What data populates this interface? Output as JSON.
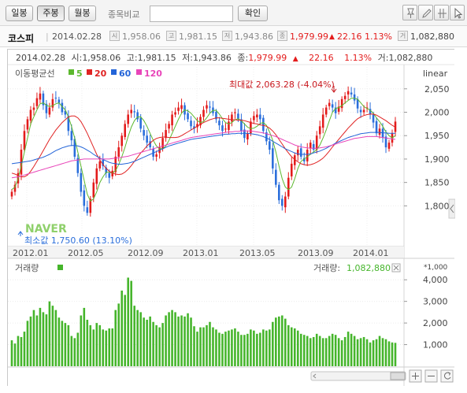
{
  "toolbar": {
    "tabs": [
      {
        "label": "일봉",
        "active": false
      },
      {
        "label": "주봉",
        "active": true
      },
      {
        "label": "월봉",
        "active": false
      }
    ],
    "compare_label": "종목비교",
    "compare_input_value": "",
    "confirm_label": "확인",
    "tools": [
      "pin-icon",
      "pencil-icon",
      "crosshair-icon",
      "cursor-icon"
    ]
  },
  "infobar": {
    "index_name": "코스피",
    "date": "2014.02.28",
    "open_icon": "시",
    "open": "1,958.06",
    "high_icon": "고",
    "high": "1,981.15",
    "low_icon": "저",
    "low": "1,943.86",
    "close_icon": "종",
    "close": "1,979.99",
    "change_arrow": "▲",
    "change": "22.16",
    "change_pct": "1.13%",
    "volume_icon": "거",
    "volume": "1,082,880"
  },
  "chart": {
    "header": {
      "date": "2014.02.28",
      "open_label": "시:",
      "open": "1,958.06",
      "high_label": "고:",
      "high": "1,981.15",
      "low_label": "저:",
      "low": "1,943.86",
      "close_label": "종:",
      "close": "1,979.99",
      "arrow": "▲",
      "change": "22.16",
      "change_pct": "1.13%",
      "volume_label": "거:",
      "volume": "1,082,880"
    },
    "ma_label": "이동평균선",
    "ma_legend": [
      {
        "label": "5",
        "color": "#5cb82e"
      },
      {
        "label": "20",
        "color": "#e02323"
      },
      {
        "label": "60",
        "color": "#2364d8"
      },
      {
        "label": "120",
        "color": "#e845b9"
      }
    ],
    "scale_label": "linear",
    "max_annotation": "최대값 2,063.28 (-4.04%)",
    "min_annotation": "최소값 1,750.60 (13.10%)",
    "watermark": "NAVER",
    "volume_title": "거래량",
    "volume_readout_label": "거래량:",
    "volume_readout_value": "1,082,880",
    "volume_unit": "*1,000",
    "colors": {
      "up": "#e31b1b",
      "down": "#2a6edb",
      "volume": "#45b52b"
    }
  },
  "chart_data": [
    {
      "type": "candlestick",
      "title": "",
      "x_tick_labels": [
        "2012.01",
        "2012.05",
        "2012.09",
        "2013.01",
        "2013.05",
        "2013.09",
        "2014.01"
      ],
      "y_tick_labels": [
        "2,050",
        "2,000",
        "1,950",
        "1,900",
        "1,850",
        "1,800"
      ],
      "ylim": [
        1730,
        2090
      ],
      "scale": "linear",
      "series": [
        {
          "name": "close",
          "values": [
            1830,
            1845,
            1870,
            1920,
            1960,
            1985,
            2005,
            2010,
            2030,
            2040,
            2015,
            1998,
            2010,
            2028,
            2030,
            2020,
            2000,
            1995,
            1960,
            1940,
            1905,
            1870,
            1830,
            1800,
            1785,
            1815,
            1850,
            1880,
            1895,
            1885,
            1870,
            1860,
            1875,
            1905,
            1925,
            1950,
            1975,
            1995,
            2005,
            2000,
            1985,
            1965,
            1950,
            1935,
            1925,
            1905,
            1910,
            1925,
            1945,
            1962,
            1975,
            1995,
            2000,
            2010,
            2015,
            1995,
            1985,
            1970,
            1965,
            1975,
            1990,
            2005,
            2015,
            2010,
            1998,
            1985,
            1972,
            1960,
            1965,
            1980,
            1995,
            2000,
            1985,
            1960,
            1945,
            1955,
            1980,
            1992,
            1995,
            1985,
            1960,
            1938,
            1920,
            1880,
            1845,
            1812,
            1800,
            1820,
            1860,
            1890,
            1908,
            1920,
            1905,
            1895,
            1920,
            1935,
            1920,
            1950,
            1970,
            1995,
            2010,
            2020,
            2010,
            1998,
            2012,
            2028,
            2035,
            2045,
            2038,
            2025,
            2008,
            2000,
            2005,
            2010,
            1995,
            1978,
            1955,
            1965,
            1945,
            1925,
            1935,
            1955,
            1980
          ]
        },
        {
          "name": "5",
          "values": [
            1835,
            1840,
            1858,
            1885,
            1915,
            1945,
            1975,
            1990,
            2005,
            2018,
            2020,
            2015,
            2012,
            2014,
            2018,
            2020,
            2012,
            2005,
            1990,
            1970,
            1945,
            1915,
            1885,
            1855,
            1825,
            1810,
            1815,
            1830,
            1850,
            1862,
            1872,
            1872,
            1870,
            1875,
            1888,
            1905,
            1925,
            1948,
            1968,
            1982,
            1990,
            1990,
            1982,
            1970,
            1955,
            1940,
            1928,
            1922,
            1922,
            1928,
            1940,
            1955,
            1970,
            1985,
            1998,
            2005,
            2003,
            1998,
            1990,
            1982,
            1978,
            1980,
            1988,
            1998,
            2004,
            2004,
            1996,
            1986,
            1978,
            1975,
            1978,
            1984,
            1986,
            1982,
            1975,
            1968,
            1965,
            1966,
            1970,
            1976,
            1978,
            1972,
            1958,
            1940,
            1915,
            1885,
            1858,
            1840,
            1835,
            1840,
            1858,
            1880,
            1895,
            1900,
            1905,
            1910,
            1915,
            1920,
            1930,
            1945,
            1962,
            1982,
            2000,
            2008,
            2010,
            2014,
            2020,
            2025,
            2030,
            2030,
            2028,
            2020,
            2012,
            2008,
            2004,
            1998,
            1988,
            1980,
            1970,
            1958,
            1950,
            1945,
            1950
          ]
        },
        {
          "name": "20",
          "values": [
            1870,
            1868,
            1865,
            1862,
            1862,
            1866,
            1874,
            1884,
            1895,
            1906,
            1918,
            1930,
            1942,
            1952,
            1962,
            1970,
            1978,
            1984,
            1990,
            1992,
            1992,
            1988,
            1980,
            1968,
            1955,
            1940,
            1925,
            1910,
            1898,
            1888,
            1880,
            1874,
            1870,
            1868,
            1867,
            1868,
            1872,
            1878,
            1886,
            1895,
            1904,
            1913,
            1920,
            1928,
            1934,
            1940,
            1944,
            1946,
            1947,
            1947,
            1946,
            1946,
            1946,
            1947,
            1950,
            1954,
            1958,
            1962,
            1966,
            1970,
            1974,
            1978,
            1981,
            1984,
            1986,
            1988,
            1988,
            1987,
            1986,
            1985,
            1984,
            1984,
            1983,
            1983,
            1982,
            1980,
            1978,
            1976,
            1975,
            1973,
            1972,
            1970,
            1966,
            1960,
            1952,
            1942,
            1932,
            1922,
            1913,
            1905,
            1899,
            1894,
            1890,
            1888,
            1887,
            1888,
            1890,
            1893,
            1897,
            1902,
            1909,
            1917,
            1926,
            1934,
            1942,
            1950,
            1958,
            1966,
            1973,
            1980,
            1986,
            1990,
            1993,
            1995,
            1996,
            1996,
            1994,
            1990,
            1986,
            1982,
            1977,
            1972,
            1968
          ]
        },
        {
          "name": "60",
          "values": [
            1890,
            1891,
            1892,
            1893,
            1894,
            1895,
            1896,
            1898,
            1900,
            1902,
            1904,
            1907,
            1910,
            1914,
            1918,
            1921,
            1924,
            1926,
            1928,
            1929,
            1929,
            1928,
            1926,
            1923,
            1919,
            1915,
            1910,
            1906,
            1902,
            1899,
            1896,
            1893,
            1891,
            1890,
            1889,
            1889,
            1890,
            1891,
            1893,
            1895,
            1898,
            1901,
            1904,
            1907,
            1910,
            1913,
            1916,
            1919,
            1922,
            1925,
            1928,
            1930,
            1932,
            1934,
            1936,
            1938,
            1940,
            1942,
            1943,
            1944,
            1945,
            1946,
            1947,
            1948,
            1949,
            1950,
            1951,
            1952,
            1953,
            1953,
            1954,
            1954,
            1955,
            1955,
            1955,
            1955,
            1954,
            1953,
            1952,
            1950,
            1948,
            1945,
            1942,
            1938,
            1934,
            1930,
            1926,
            1922,
            1919,
            1916,
            1913,
            1911,
            1910,
            1910,
            1910,
            1911,
            1913,
            1915,
            1917,
            1920,
            1923,
            1927,
            1930,
            1934,
            1937,
            1940,
            1943,
            1946,
            1948,
            1950,
            1952,
            1954,
            1955,
            1956,
            1957,
            1957,
            1957,
            1957,
            1956,
            1956,
            1955,
            1955,
            1955
          ]
        },
        {
          "name": "120",
          "values": [
            1860,
            1861,
            1862,
            1864,
            1866,
            1868,
            1870,
            1872,
            1874,
            1876,
            1878,
            1880,
            1882,
            1884,
            1886,
            1888,
            1890,
            1892,
            1894,
            1896,
            1897,
            1898,
            1899,
            1900,
            1900,
            1900,
            1900,
            1900,
            1900,
            1900,
            1900,
            1900,
            1901,
            1902,
            1903,
            1904,
            1905,
            1906,
            1908,
            1910,
            1912,
            1914,
            1916,
            1918,
            1920,
            1922,
            1924,
            1926,
            1928,
            1930,
            1932,
            1934,
            1936,
            1938,
            1940,
            1942,
            1944,
            1946,
            1947,
            1948,
            1949,
            1950,
            1951,
            1952,
            1953,
            1954,
            1955,
            1956,
            1957,
            1958,
            1958,
            1959,
            1959,
            1960,
            1960,
            1960,
            1960,
            1959,
            1958,
            1957,
            1956,
            1954,
            1952,
            1950,
            1948,
            1945,
            1942,
            1939,
            1936,
            1933,
            1930,
            1928,
            1926,
            1925,
            1924,
            1923,
            1923,
            1923,
            1924,
            1925,
            1926,
            1928,
            1930,
            1932,
            1934,
            1936,
            1938,
            1940,
            1942,
            1944,
            1945,
            1946,
            1947,
            1948,
            1948,
            1948,
            1948,
            1947,
            1946,
            1945,
            1944,
            1943,
            1942
          ]
        }
      ]
    },
    {
      "type": "bar",
      "title": "",
      "y_tick_labels": [
        "4,000",
        "3,000",
        "2,000",
        "1,000"
      ],
      "ylim": [
        0,
        4300
      ],
      "unit": "*1,000",
      "series": [
        {
          "name": "거래량",
          "values": [
            1200,
            1050,
            1400,
            1350,
            1600,
            2100,
            2300,
            2600,
            2350,
            2700,
            2500,
            2400,
            3000,
            2800,
            2600,
            2250,
            2100,
            2000,
            1900,
            1400,
            1300,
            1550,
            2350,
            2700,
            2150,
            1900,
            1700,
            2000,
            1900,
            1700,
            1650,
            1750,
            1750,
            2600,
            2900,
            3500,
            3300,
            4100,
            3950,
            2800,
            2600,
            2500,
            2250,
            2150,
            2300,
            2050,
            1900,
            1800,
            2000,
            2350,
            2500,
            2600,
            2500,
            2300,
            2350,
            2300,
            2450,
            2250,
            1850,
            1600,
            1800,
            1800,
            1900,
            2050,
            1800,
            1700,
            1550,
            1500,
            1600,
            1650,
            1700,
            1750,
            1600,
            1450,
            1450,
            1500,
            1700,
            1650,
            1500,
            1550,
            1700,
            1650,
            1700,
            2050,
            2250,
            2300,
            2350,
            2200,
            1900,
            1800,
            1750,
            1650,
            1500,
            1450,
            1400,
            1300,
            1350,
            1500,
            1400,
            1300,
            1300,
            1400,
            1500,
            1450,
            1300,
            1200,
            1350,
            1600,
            1500,
            1400,
            1250,
            1300,
            1350,
            1250,
            1100,
            1200,
            1250,
            1400,
            1300,
            1250,
            1150,
            1100,
            1082
          ]
        }
      ]
    }
  ]
}
